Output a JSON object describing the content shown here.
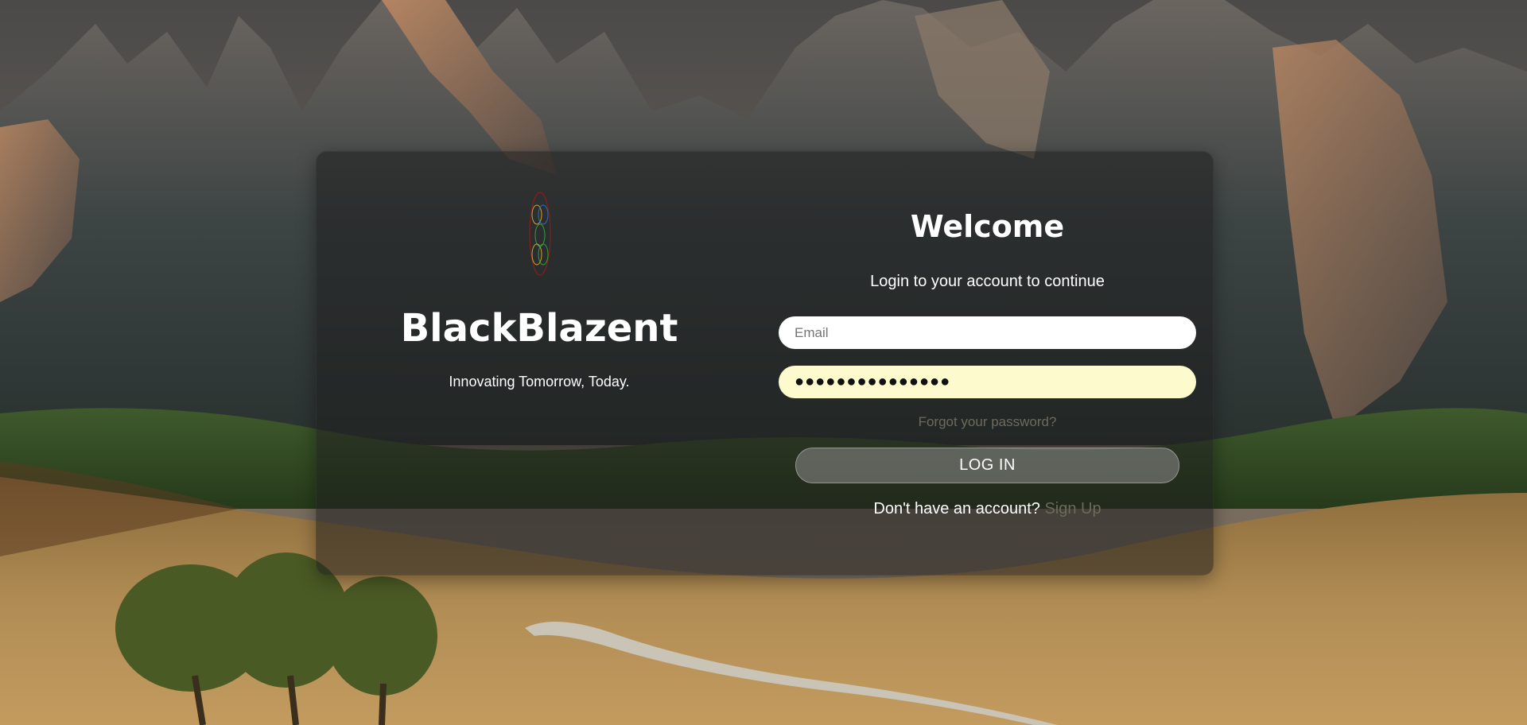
{
  "brand": {
    "name": "BlackBlazent",
    "tagline": "Innovating Tomorrow, Today."
  },
  "login": {
    "title": "Welcome",
    "subtitle": "Login to your account to continue",
    "email_placeholder": "Email",
    "email_value": "",
    "password_value": "●●●●●●●●●●●●●●●",
    "forgot_password": "Forgot your password?",
    "login_button": "LOG IN",
    "no_account_text": "Don't have an account?",
    "signup_link": "Sign Up"
  },
  "icons": {
    "logo": "blackblazent-logo-icon"
  },
  "colors": {
    "password_field_bg": "#fdfbce",
    "email_field_bg": "#ffffff",
    "card_bg": "rgba(30,30,30,0.55)",
    "link_muted": "#6a6b58"
  }
}
